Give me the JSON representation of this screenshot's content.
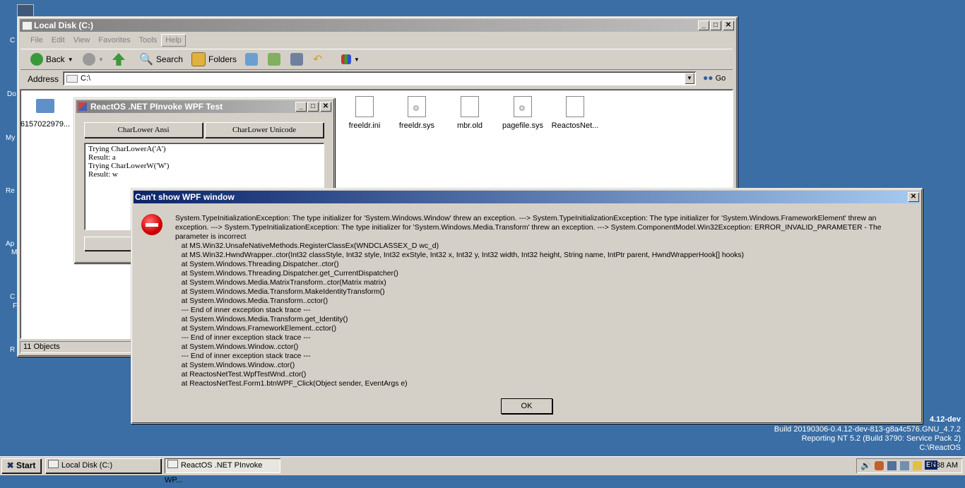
{
  "desktop": {
    "labels": [
      "C",
      "Do",
      "My",
      "Re",
      "Ap",
      "M",
      "C",
      "F",
      "R"
    ],
    "build_info": {
      "version": "4.12-dev",
      "build": "Build 20190306-0.4.12-dev-813-g8a4c576.GNU_4.7.2",
      "reporting": "Reporting NT 5.2 (Build 3790: Service Pack 2)",
      "path": "C:\\ReactOS"
    }
  },
  "explorer": {
    "title": "Local Disk (C:)",
    "menu": [
      "File",
      "Edit",
      "View",
      "Favorites",
      "Tools",
      "Help"
    ],
    "toolbar": {
      "back": "Back",
      "search": "Search",
      "folders": "Folders"
    },
    "address_label": "Address",
    "address_value": "C:\\",
    "go_label": "Go",
    "files": [
      "6157022979...",
      "freeldr.ini",
      "freeldr.sys",
      "mbr.old",
      "pagefile.sys",
      "ReactosNet..."
    ],
    "status": "11 Objects"
  },
  "pinvoke": {
    "title": "ReactOS .NET PInvoke WPF Test",
    "btn_ansi": "CharLower Ansi",
    "btn_unicode": "CharLower Unicode",
    "output": [
      "Trying CharLowerA('A')",
      "Result: a",
      "Trying CharLowerW('W')",
      "Result: w"
    ]
  },
  "dialog": {
    "title": "Can't show WPF window",
    "message": [
      "System.TypeInitializationException: The type initializer for 'System.Windows.Window' threw an exception. ---> System.TypeInitializationException: The type initializer for 'System.Windows.FrameworkElement' threw an",
      "exception. ---> System.TypeInitializationException: The type initializer for 'System.Windows.Media.Transform' threw an exception. ---> System.ComponentModel.Win32Exception: ERROR_INVALID_PARAMETER - The",
      "parameter is incorrect",
      "   at MS.Win32.UnsafeNativeMethods.RegisterClassEx(WNDCLASSEX_D wc_d)",
      "   at MS.Win32.HwndWrapper..ctor(Int32 classStyle, Int32 style, Int32 exStyle, Int32 x, Int32 y, Int32 width, Int32 height, String name, IntPtr parent, HwndWrapperHook[] hooks)",
      "   at System.Windows.Threading.Dispatcher..ctor()",
      "   at System.Windows.Threading.Dispatcher.get_CurrentDispatcher()",
      "   at System.Windows.Media.MatrixTransform..ctor(Matrix matrix)",
      "   at System.Windows.Media.Transform.MakeIdentityTransform()",
      "   at System.Windows.Media.Transform..cctor()",
      "   --- End of inner exception stack trace ---",
      "   at System.Windows.Media.Transform.get_Identity()",
      "   at System.Windows.FrameworkElement..cctor()",
      "   --- End of inner exception stack trace ---",
      "   at System.Windows.Window..cctor()",
      "   --- End of inner exception stack trace ---",
      "   at System.Windows.Window..ctor()",
      "   at ReactosNetTest.WpfTestWnd..ctor()",
      "   at ReactosNetTest.Form1.btnWPF_Click(Object sender, EventArgs e)"
    ],
    "ok_label": "OK"
  },
  "taskbar": {
    "start_label": "Start",
    "tasks": [
      "Local Disk (C:)",
      "ReactOS .NET PInvoke WP..."
    ],
    "lang": "EN",
    "clock": "9:38 AM"
  }
}
